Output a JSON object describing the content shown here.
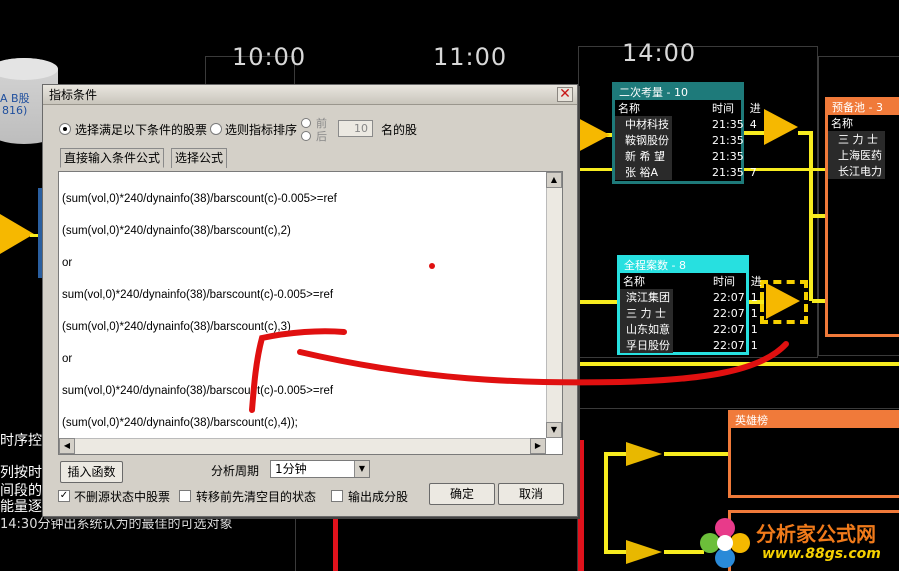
{
  "background": {
    "times": [
      "10:00",
      "11:00",
      "14:00"
    ],
    "cylinder": {
      "line1": "A B股",
      "line2": "816)"
    },
    "panel_second": {
      "title": "二次考量 - 10",
      "headers": [
        "名称",
        "时间",
        "进"
      ],
      "rows": [
        [
          "中材科技",
          "21:35",
          "4"
        ],
        [
          "鞍钢股份",
          "21:35",
          ""
        ],
        [
          "新 希 望",
          "21:35",
          ""
        ],
        [
          "张  裕A",
          "21:35",
          "7"
        ]
      ]
    },
    "panel_full": {
      "title": "全程案数 - 8",
      "headers": [
        "名称",
        "时间",
        "进"
      ],
      "rows": [
        [
          "滨江集团",
          "22:07",
          "1"
        ],
        [
          "三 力 士",
          "22:07",
          "1"
        ],
        [
          "山东如意",
          "22:07",
          "1"
        ],
        [
          "孚日股份",
          "22:07",
          "1"
        ]
      ]
    },
    "panel_pool": {
      "title": "预备池 - 3",
      "headers": [
        "名称"
      ],
      "rows": [
        "三 力 士",
        "上海医药",
        "长江电力"
      ]
    },
    "panel_hero": {
      "title": "英雄榜"
    },
    "side_texts": [
      "时序控",
      "列按时",
      "间段的",
      "能量逐",
      "14:30分钟出系统认为的最佳的可选对象"
    ],
    "watermark": {
      "name": "分析家公式网",
      "url": "www.88gs.com"
    },
    "colors": {
      "wire": "#f7ec1f",
      "red_wire": "#e0121c",
      "teal": "#1e7a7a",
      "cyan": "#27e0e0",
      "orange": "#f07a3a"
    }
  },
  "dialog": {
    "title": "指标条件",
    "radio_condition": "选择满足以下条件的股票",
    "radio_rank": "选则指标排序",
    "front": "前",
    "back": "后",
    "rank_count": "10",
    "rank_suffix": "名的股",
    "tabs": [
      "直接输入条件公式",
      "选择公式"
    ],
    "formula": [
      "(sum(vol,0)*240/dynainfo(38)/barscount(c)-0.005>=ref",
      "(sum(vol,0)*240/dynainfo(38)/barscount(c),2)",
      "or",
      "sum(vol,0)*240/dynainfo(38)/barscount(c)-0.005>=ref",
      "(sum(vol,0)*240/dynainfo(38)/barscount(c),3)",
      "or",
      "sum(vol,0)*240/dynainfo(38)/barscount(c)-0.005>=ref",
      "(sum(vol,0)*240/dynainfo(38)/barscount(c),4));"
    ],
    "insert_function": "插入函数",
    "period_label": "分析周期",
    "period_value": "1分钟",
    "check_source": "不删源状态中股票",
    "check_clear": "转移前先清空目的状态",
    "check_output": "输出成分股",
    "ok": "确定",
    "cancel": "取消"
  }
}
